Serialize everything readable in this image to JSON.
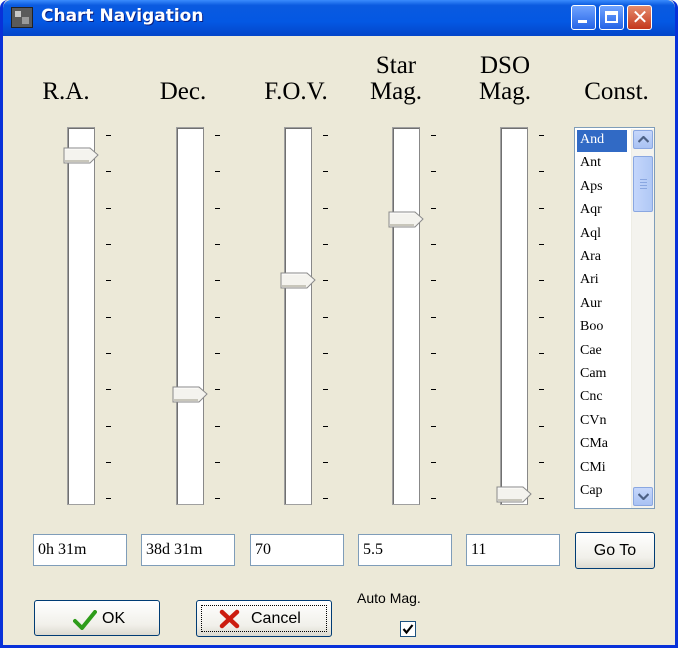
{
  "window": {
    "title": "Chart Navigation",
    "icon": "app-chart-icon",
    "controls": [
      "minimize-icon",
      "maximize-icon",
      "close-icon"
    ]
  },
  "columns": {
    "ra": {
      "label": "R.A.",
      "value": "0h 31m",
      "position_fraction": 0.05
    },
    "dec": {
      "label": "Dec.",
      "value": "38d 31m",
      "position_fraction": 0.72
    },
    "fov": {
      "label": "F.O.V.",
      "value": "70",
      "position_fraction": 0.4
    },
    "star_mag": {
      "label_line1": "Star",
      "label_line2": "Mag.",
      "value": "5.5",
      "position_fraction": 0.23
    },
    "dso_mag": {
      "label_line1": "DSO",
      "label_line2": "Mag.",
      "value": "11",
      "position_fraction": 1.0
    },
    "const": {
      "label": "Const."
    }
  },
  "constellations": {
    "selected": "And",
    "items": [
      "And",
      "Ant",
      "Aps",
      "Aqr",
      "Aql",
      "Ara",
      "Ari",
      "Aur",
      "Boo",
      "Cae",
      "Cam",
      "Cnc",
      "CVn",
      "CMa",
      "CMi",
      "Cap"
    ]
  },
  "buttons": {
    "goto": "Go To",
    "ok": "OK",
    "cancel": "Cancel"
  },
  "auto_mag": {
    "label": "Auto Mag.",
    "checked": true
  },
  "colors": {
    "accent": "#316ac5",
    "ok_check": "#2e9c1a",
    "cancel_x": "#cc1d10"
  }
}
